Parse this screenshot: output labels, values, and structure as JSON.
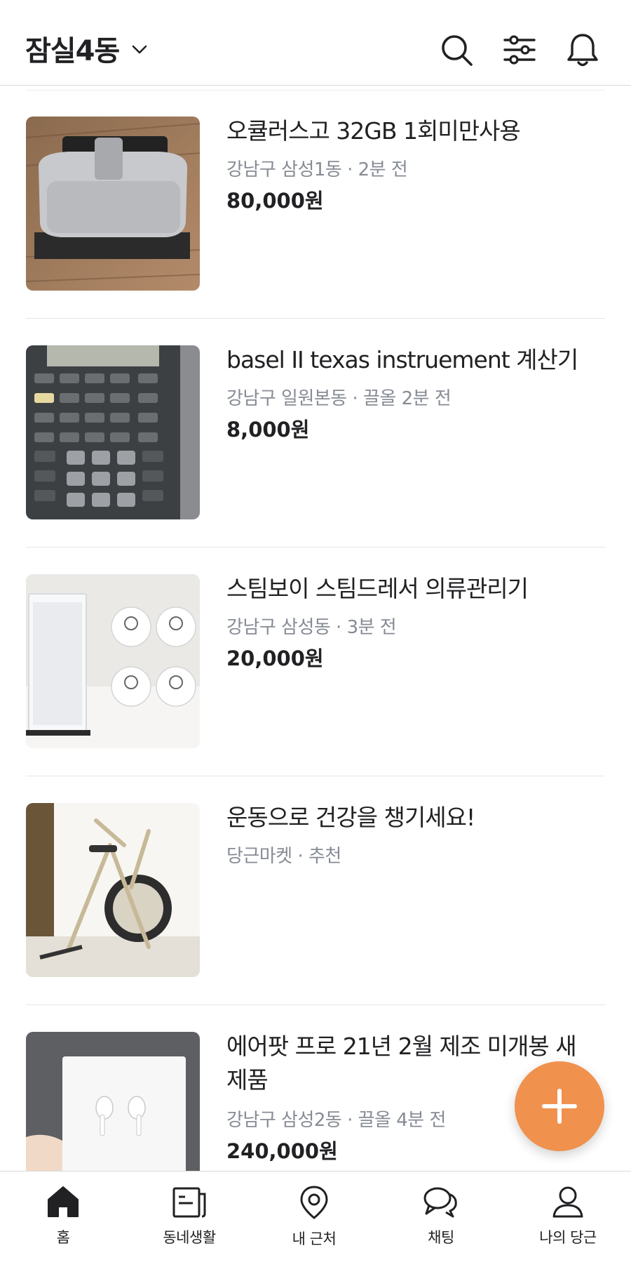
{
  "header": {
    "location": "잠실4동",
    "icons": [
      "search-icon",
      "filter-icon",
      "bell-icon"
    ]
  },
  "items": [
    {
      "title": "오큘러스고 32GB 1회미만사용",
      "location": "강남구 삼성1동",
      "time": "2분 전",
      "meta": "강남구 삼성1동 · 2분 전",
      "price": "80,000원",
      "image": "vr-headset"
    },
    {
      "title": "basel II texas instruement 계산기",
      "location": "강남구 일원본동",
      "time": "끌올 2분 전",
      "meta": "강남구 일원본동 · 끌올 2분 전",
      "price": "8,000원",
      "image": "calculator"
    },
    {
      "title": "스팀보이 스팀드레서 의류관리기",
      "location": "강남구 삼성동",
      "time": "3분 전",
      "meta": "강남구 삼성동 · 3분 전",
      "price": "20,000원",
      "image": "steam-dresser"
    },
    {
      "title": "운동으로 건강을 챙기세요!",
      "location": "당근마켓",
      "time": "추천",
      "meta": "당근마켓 · 추천",
      "price": "",
      "image": "exercise-bike"
    },
    {
      "title": "에어팟 프로 21년 2월 제조 미개봉 새 제품",
      "location": "강남구 삼성2동",
      "time": "끌올 4분 전",
      "meta": "강남구 삼성2동 · 끌올 4분 전",
      "price": "240,000원",
      "image": "airpods-box"
    }
  ],
  "nav": [
    {
      "label": "홈",
      "icon": "home-icon"
    },
    {
      "label": "동네생활",
      "icon": "news-icon"
    },
    {
      "label": "내 근처",
      "icon": "location-pin-icon"
    },
    {
      "label": "채팅",
      "icon": "chat-icon"
    },
    {
      "label": "나의 당근",
      "icon": "user-icon"
    }
  ],
  "colors": {
    "accent": "#f0914e",
    "meta": "#868b94",
    "text": "#212124"
  }
}
